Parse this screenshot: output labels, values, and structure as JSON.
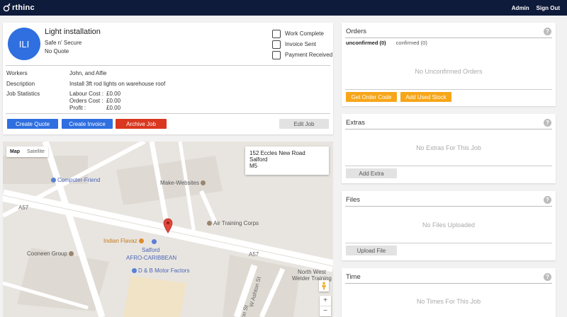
{
  "header": {
    "brand": "rthinc",
    "nav": [
      "Admin",
      "Sign Out"
    ]
  },
  "job": {
    "initials": "ILI",
    "title": "Light installation",
    "customer": "Safe n' Secure",
    "quote_status": "No Quote",
    "checkboxes": [
      "Work Complete",
      "Invoice Sent",
      "Payment Received"
    ],
    "workers_label": "Workers",
    "workers": "John, and Alfie",
    "description_label": "Description",
    "description": "Install 3ft rod lights on warehouse roof",
    "stats_label": "Job Statistics",
    "stats": [
      {
        "label": "Labour Cost :",
        "value": "£0.00"
      },
      {
        "label": "Orders Cost :",
        "value": "£0.00"
      },
      {
        "label": "Profit :",
        "value": "£0.00"
      }
    ],
    "buttons": {
      "create_quote": "Create Quote",
      "create_invoice": "Create Invoice",
      "archive": "Archive Job",
      "edit": "Edit Job"
    }
  },
  "map": {
    "toggle": {
      "map": "Map",
      "satellite": "Satellite"
    },
    "address": [
      "152 Eccles New Road",
      "Salford",
      "M5"
    ],
    "pois": {
      "computer_friend": "Computer-Friend",
      "make_websites": "Make-Websites",
      "air_training": "Air Training Corps",
      "coneen": "Cooneen Group",
      "indian_flavaz": "Indian Flavaz",
      "salford": "Salford",
      "afro": "AFRO-CARIBBEAN",
      "db_motor": "D & B Motor Factors",
      "north_west_1": "North West",
      "north_west_2": "Welder Training"
    },
    "roads": {
      "a57_left": "A57",
      "a57_right": "A57",
      "w_ashton": "W Ashton St",
      "on_st": "on St"
    },
    "zoom_in": "+",
    "zoom_out": "−"
  },
  "orders": {
    "title": "Orders",
    "help": "?",
    "tab_unconfirmed": "unconfirmed (0)",
    "tab_confirmed": "confirmed (0)",
    "empty": "No Unconfirmed Orders",
    "btn_order_code": "Get Order Code",
    "btn_used_stock": "Add Used Stock"
  },
  "extras": {
    "title": "Extras",
    "help": "?",
    "empty": "No Extras For This Job",
    "btn": "Add Extra"
  },
  "files": {
    "title": "Files",
    "help": "?",
    "empty": "No Files Uploaded",
    "btn": "Upload File"
  },
  "time": {
    "title": "Time",
    "help": "?",
    "empty": "No Times For This Job"
  },
  "colors": {
    "topbar": "#0f1b3a",
    "primary": "#2f6fe0",
    "danger": "#d9371f",
    "warning": "#f6a618"
  }
}
